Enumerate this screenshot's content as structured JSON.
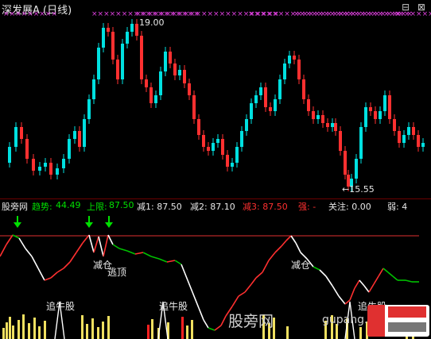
{
  "title": "深发展A (日线)",
  "window_controls": "⊟ ⊠",
  "price_chart": {
    "high_label": "19.00",
    "low_label": "←15.55",
    "up_color": "#e8e8e8",
    "up_fill": "#00e0e0",
    "down_color": "#ff3030",
    "marker_color": "#e040e0",
    "marker_text": "×××"
  },
  "indicator_bar": {
    "name": "股旁网",
    "trend_label": "趋势:",
    "trend_value": "44.49",
    "upper_label": "上限:",
    "upper_value": "87.50",
    "reduce1": "减1: 87.50",
    "reduce2": "减2: 87.10",
    "reduce3": "减3: 87.50",
    "strong": "强: -",
    "focus": "关注: 0.00",
    "weak": "弱: 4"
  },
  "annotations": {
    "reduce_pos": "减仓",
    "reduce_pos2": "减仓",
    "escape_top": "逃顶",
    "chase_1": "追牛股",
    "chase_2": "追牛股",
    "chase_3": "追牛股",
    "watermark": "股旁网",
    "watermark_url": "gupang.com"
  },
  "chart_data": {
    "type": "line",
    "upper_limit": 87.5,
    "trend_current": 44.49
  }
}
